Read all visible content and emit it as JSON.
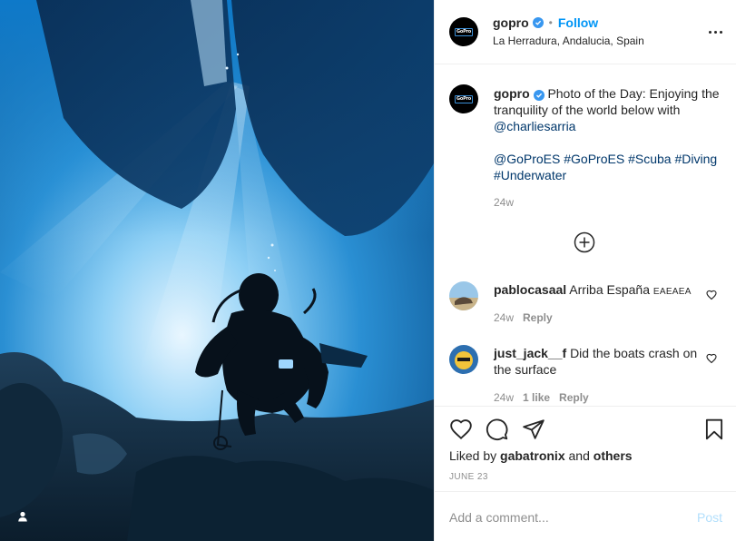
{
  "post": {
    "username": "gopro",
    "avatar_logo_text": "GoPro",
    "follow_label": "Follow",
    "separator": "•",
    "location": "La Herradura, Andalucia, Spain"
  },
  "caption": {
    "username": "gopro",
    "text": "Photo of the Day: Enjoying the tranquility of the world below with",
    "mention": "@charliesarria",
    "tags": [
      "@GoProES",
      "#GoProES",
      "#Scuba",
      "#Diving",
      "#Underwater"
    ],
    "time": "24w"
  },
  "comments": [
    {
      "username": "pablocasaal",
      "text": "Arriba España",
      "suffix": "EAEAEA",
      "time": "24w",
      "reply_label": "Reply"
    },
    {
      "username": "just_jack__f",
      "text": "Did the boats crash on the surface",
      "time": "24w",
      "likes": "1 like",
      "reply_label": "Reply"
    }
  ],
  "likes": {
    "prefix": "Liked by",
    "user": "gabatronix",
    "conjunction": "and",
    "others": "others"
  },
  "date": "JUNE 23",
  "add_comment": {
    "placeholder": "Add a comment...",
    "post_label": "Post"
  },
  "colors": {
    "accent": "#0095f6",
    "post_disabled": "#b2dffc",
    "border": "#efefef",
    "ocean": "#0f5f9e"
  }
}
